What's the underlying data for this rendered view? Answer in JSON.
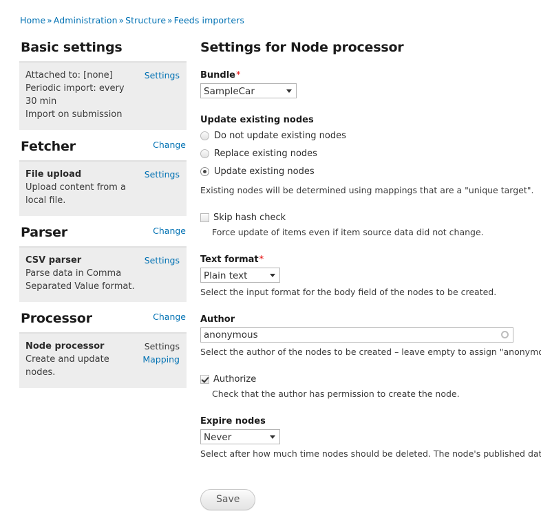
{
  "breadcrumb": {
    "separator": "»",
    "items": [
      {
        "label": "Home"
      },
      {
        "label": "Administration"
      },
      {
        "label": "Structure"
      },
      {
        "label": "Feeds importers"
      }
    ]
  },
  "sidebar": {
    "sections": [
      {
        "heading": "Basic settings",
        "action": null,
        "box": {
          "title": null,
          "lines": [
            "Attached to: [none]",
            "Periodic import: every 30 min",
            "Import on submission"
          ],
          "links": [
            {
              "label": "Settings",
              "is_link": true
            }
          ]
        }
      },
      {
        "heading": "Fetcher",
        "action": "Change",
        "box": {
          "title": "File upload",
          "lines": [
            "Upload content from a local file."
          ],
          "links": [
            {
              "label": "Settings",
              "is_link": true
            }
          ]
        }
      },
      {
        "heading": "Parser",
        "action": "Change",
        "box": {
          "title": "CSV parser",
          "lines": [
            "Parse data in Comma Separated Value format."
          ],
          "links": [
            {
              "label": "Settings",
              "is_link": true
            }
          ]
        }
      },
      {
        "heading": "Processor",
        "action": "Change",
        "box": {
          "title": "Node processor",
          "lines": [
            "Create and update nodes."
          ],
          "links": [
            {
              "label": "Settings",
              "is_link": false
            },
            {
              "label": "Mapping",
              "is_link": true
            }
          ]
        }
      }
    ]
  },
  "main": {
    "title": "Settings for Node processor",
    "required_marker": "*",
    "bundle": {
      "label": "Bundle",
      "required": true,
      "value": "SampleCar",
      "options": [
        "SampleCar"
      ]
    },
    "update_existing": {
      "label": "Update existing nodes",
      "options": [
        {
          "label": "Do not update existing nodes",
          "checked": false
        },
        {
          "label": "Replace existing nodes",
          "checked": false
        },
        {
          "label": "Update existing nodes",
          "checked": true
        }
      ],
      "description": "Existing nodes will be determined using mappings that are a \"unique target\"."
    },
    "skip_hash_check": {
      "label": "Skip hash check",
      "checked": false,
      "description": "Force update of items even if item source data did not change."
    },
    "text_format": {
      "label": "Text format",
      "required": true,
      "value": "Plain text",
      "options": [
        "Plain text"
      ],
      "description": "Select the input format for the body field of the nodes to be created."
    },
    "author": {
      "label": "Author",
      "value": "anonymous",
      "placeholder": "",
      "icon": "throbber-icon",
      "description": "Select the author of the nodes to be created – leave empty to assign \"anonymous\"."
    },
    "authorize": {
      "label": "Authorize",
      "checked": true,
      "description": "Check that the author has permission to create the node."
    },
    "expire_nodes": {
      "label": "Expire nodes",
      "value": "Never",
      "options": [
        "Never"
      ],
      "description": "Select after how much time nodes should be deleted. The node's published date will"
    },
    "save_label": "Save"
  },
  "colors": {
    "link": "#0071b3",
    "required": "#e40303",
    "box_bg": "#ededed",
    "text": "#3b3b3b"
  }
}
